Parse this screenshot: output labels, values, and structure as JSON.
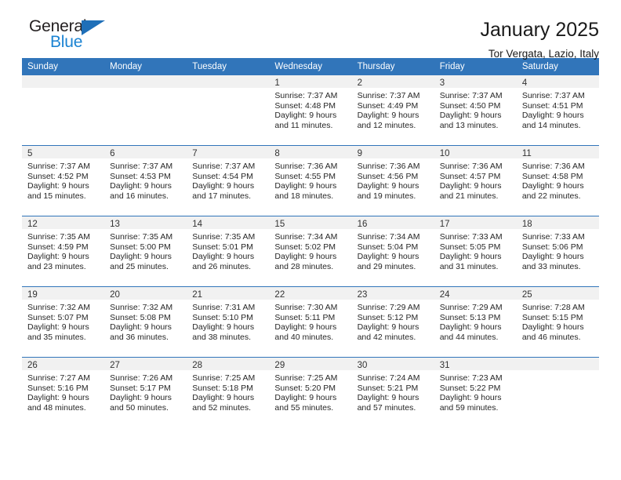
{
  "brand": {
    "name_part1": "General",
    "name_part2": "Blue",
    "accent_color": "#1b83d2",
    "triangle_color": "#1f6fb8"
  },
  "header": {
    "title": "January 2025",
    "subtitle": "Tor Vergata, Lazio, Italy"
  },
  "calendar": {
    "header_bg": "#3175ba",
    "daynum_bg": "#f1f1f1",
    "weekday_names": [
      "Sunday",
      "Monday",
      "Tuesday",
      "Wednesday",
      "Thursday",
      "Friday",
      "Saturday"
    ],
    "weeks": [
      [
        {
          "day": ""
        },
        {
          "day": ""
        },
        {
          "day": ""
        },
        {
          "day": "1",
          "sunrise": "Sunrise: 7:37 AM",
          "sunset": "Sunset: 4:48 PM",
          "daylight_line1": "Daylight: 9 hours",
          "daylight_line2": "and 11 minutes."
        },
        {
          "day": "2",
          "sunrise": "Sunrise: 7:37 AM",
          "sunset": "Sunset: 4:49 PM",
          "daylight_line1": "Daylight: 9 hours",
          "daylight_line2": "and 12 minutes."
        },
        {
          "day": "3",
          "sunrise": "Sunrise: 7:37 AM",
          "sunset": "Sunset: 4:50 PM",
          "daylight_line1": "Daylight: 9 hours",
          "daylight_line2": "and 13 minutes."
        },
        {
          "day": "4",
          "sunrise": "Sunrise: 7:37 AM",
          "sunset": "Sunset: 4:51 PM",
          "daylight_line1": "Daylight: 9 hours",
          "daylight_line2": "and 14 minutes."
        }
      ],
      [
        {
          "day": "5",
          "sunrise": "Sunrise: 7:37 AM",
          "sunset": "Sunset: 4:52 PM",
          "daylight_line1": "Daylight: 9 hours",
          "daylight_line2": "and 15 minutes."
        },
        {
          "day": "6",
          "sunrise": "Sunrise: 7:37 AM",
          "sunset": "Sunset: 4:53 PM",
          "daylight_line1": "Daylight: 9 hours",
          "daylight_line2": "and 16 minutes."
        },
        {
          "day": "7",
          "sunrise": "Sunrise: 7:37 AM",
          "sunset": "Sunset: 4:54 PM",
          "daylight_line1": "Daylight: 9 hours",
          "daylight_line2": "and 17 minutes."
        },
        {
          "day": "8",
          "sunrise": "Sunrise: 7:36 AM",
          "sunset": "Sunset: 4:55 PM",
          "daylight_line1": "Daylight: 9 hours",
          "daylight_line2": "and 18 minutes."
        },
        {
          "day": "9",
          "sunrise": "Sunrise: 7:36 AM",
          "sunset": "Sunset: 4:56 PM",
          "daylight_line1": "Daylight: 9 hours",
          "daylight_line2": "and 19 minutes."
        },
        {
          "day": "10",
          "sunrise": "Sunrise: 7:36 AM",
          "sunset": "Sunset: 4:57 PM",
          "daylight_line1": "Daylight: 9 hours",
          "daylight_line2": "and 21 minutes."
        },
        {
          "day": "11",
          "sunrise": "Sunrise: 7:36 AM",
          "sunset": "Sunset: 4:58 PM",
          "daylight_line1": "Daylight: 9 hours",
          "daylight_line2": "and 22 minutes."
        }
      ],
      [
        {
          "day": "12",
          "sunrise": "Sunrise: 7:35 AM",
          "sunset": "Sunset: 4:59 PM",
          "daylight_line1": "Daylight: 9 hours",
          "daylight_line2": "and 23 minutes."
        },
        {
          "day": "13",
          "sunrise": "Sunrise: 7:35 AM",
          "sunset": "Sunset: 5:00 PM",
          "daylight_line1": "Daylight: 9 hours",
          "daylight_line2": "and 25 minutes."
        },
        {
          "day": "14",
          "sunrise": "Sunrise: 7:35 AM",
          "sunset": "Sunset: 5:01 PM",
          "daylight_line1": "Daylight: 9 hours",
          "daylight_line2": "and 26 minutes."
        },
        {
          "day": "15",
          "sunrise": "Sunrise: 7:34 AM",
          "sunset": "Sunset: 5:02 PM",
          "daylight_line1": "Daylight: 9 hours",
          "daylight_line2": "and 28 minutes."
        },
        {
          "day": "16",
          "sunrise": "Sunrise: 7:34 AM",
          "sunset": "Sunset: 5:04 PM",
          "daylight_line1": "Daylight: 9 hours",
          "daylight_line2": "and 29 minutes."
        },
        {
          "day": "17",
          "sunrise": "Sunrise: 7:33 AM",
          "sunset": "Sunset: 5:05 PM",
          "daylight_line1": "Daylight: 9 hours",
          "daylight_line2": "and 31 minutes."
        },
        {
          "day": "18",
          "sunrise": "Sunrise: 7:33 AM",
          "sunset": "Sunset: 5:06 PM",
          "daylight_line1": "Daylight: 9 hours",
          "daylight_line2": "and 33 minutes."
        }
      ],
      [
        {
          "day": "19",
          "sunrise": "Sunrise: 7:32 AM",
          "sunset": "Sunset: 5:07 PM",
          "daylight_line1": "Daylight: 9 hours",
          "daylight_line2": "and 35 minutes."
        },
        {
          "day": "20",
          "sunrise": "Sunrise: 7:32 AM",
          "sunset": "Sunset: 5:08 PM",
          "daylight_line1": "Daylight: 9 hours",
          "daylight_line2": "and 36 minutes."
        },
        {
          "day": "21",
          "sunrise": "Sunrise: 7:31 AM",
          "sunset": "Sunset: 5:10 PM",
          "daylight_line1": "Daylight: 9 hours",
          "daylight_line2": "and 38 minutes."
        },
        {
          "day": "22",
          "sunrise": "Sunrise: 7:30 AM",
          "sunset": "Sunset: 5:11 PM",
          "daylight_line1": "Daylight: 9 hours",
          "daylight_line2": "and 40 minutes."
        },
        {
          "day": "23",
          "sunrise": "Sunrise: 7:29 AM",
          "sunset": "Sunset: 5:12 PM",
          "daylight_line1": "Daylight: 9 hours",
          "daylight_line2": "and 42 minutes."
        },
        {
          "day": "24",
          "sunrise": "Sunrise: 7:29 AM",
          "sunset": "Sunset: 5:13 PM",
          "daylight_line1": "Daylight: 9 hours",
          "daylight_line2": "and 44 minutes."
        },
        {
          "day": "25",
          "sunrise": "Sunrise: 7:28 AM",
          "sunset": "Sunset: 5:15 PM",
          "daylight_line1": "Daylight: 9 hours",
          "daylight_line2": "and 46 minutes."
        }
      ],
      [
        {
          "day": "26",
          "sunrise": "Sunrise: 7:27 AM",
          "sunset": "Sunset: 5:16 PM",
          "daylight_line1": "Daylight: 9 hours",
          "daylight_line2": "and 48 minutes."
        },
        {
          "day": "27",
          "sunrise": "Sunrise: 7:26 AM",
          "sunset": "Sunset: 5:17 PM",
          "daylight_line1": "Daylight: 9 hours",
          "daylight_line2": "and 50 minutes."
        },
        {
          "day": "28",
          "sunrise": "Sunrise: 7:25 AM",
          "sunset": "Sunset: 5:18 PM",
          "daylight_line1": "Daylight: 9 hours",
          "daylight_line2": "and 52 minutes."
        },
        {
          "day": "29",
          "sunrise": "Sunrise: 7:25 AM",
          "sunset": "Sunset: 5:20 PM",
          "daylight_line1": "Daylight: 9 hours",
          "daylight_line2": "and 55 minutes."
        },
        {
          "day": "30",
          "sunrise": "Sunrise: 7:24 AM",
          "sunset": "Sunset: 5:21 PM",
          "daylight_line1": "Daylight: 9 hours",
          "daylight_line2": "and 57 minutes."
        },
        {
          "day": "31",
          "sunrise": "Sunrise: 7:23 AM",
          "sunset": "Sunset: 5:22 PM",
          "daylight_line1": "Daylight: 9 hours",
          "daylight_line2": "and 59 minutes."
        },
        {
          "day": ""
        }
      ]
    ]
  }
}
